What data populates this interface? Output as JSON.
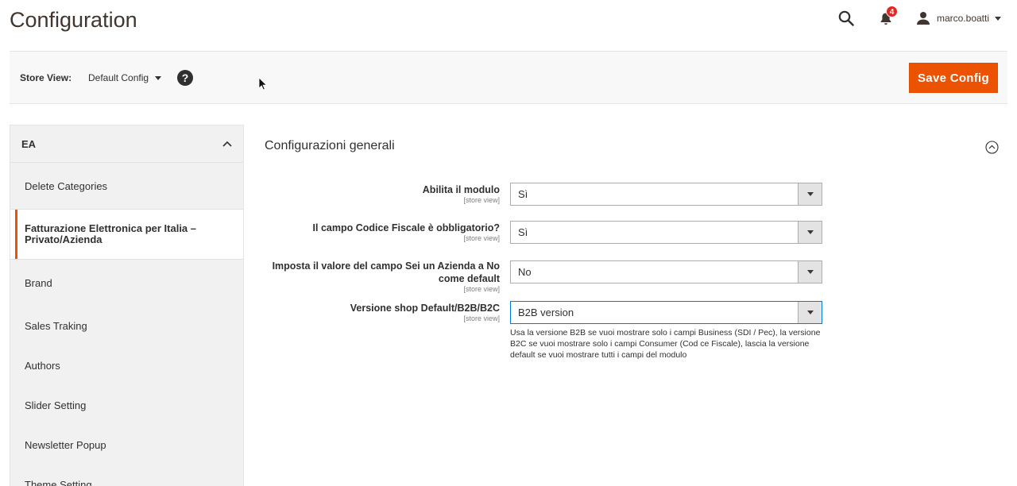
{
  "header": {
    "title": "Configuration",
    "notifications_count": "4",
    "user_name": "marco.boatti"
  },
  "store_bar": {
    "label": "Store View:",
    "selected": "Default Config",
    "help": "?",
    "save_label": "Save Config",
    "accent": "#eb5202"
  },
  "sidebar": {
    "group": "EA",
    "items": [
      {
        "label": "Delete Categories"
      },
      {
        "label": "Fatturazione Elettronica per Italia – Privato/Azienda",
        "active": true
      },
      {
        "label": "Brand"
      },
      {
        "label": "Sales Traking"
      },
      {
        "label": "Authors"
      },
      {
        "label": "Slider Setting"
      },
      {
        "label": "Newsletter Popup"
      },
      {
        "label": "Theme Setting"
      }
    ]
  },
  "section": {
    "title": "Configurazioni generali",
    "fields": [
      {
        "label": "Abilita il modulo",
        "scope": "[store view]",
        "value": "Sì"
      },
      {
        "label": "Il campo Codice Fiscale è obbligatorio?",
        "scope": "[store view]",
        "value": "Sì"
      },
      {
        "label": "Imposta il valore del campo Sei un Azienda a No come default",
        "scope": "[store view]",
        "value": "No"
      },
      {
        "label": "Versione shop Default/B2B/B2C",
        "scope": "[store view]",
        "value": "B2B version"
      }
    ],
    "note": "Usa la versione B2B se vuoi mostrare solo i campi Business (SDI / Pec), la versione B2C se vuoi mostrare solo i campi Consumer (Cod ce Fiscale), lascia la versione default se vuoi mostrare tutti i campi del modulo"
  }
}
